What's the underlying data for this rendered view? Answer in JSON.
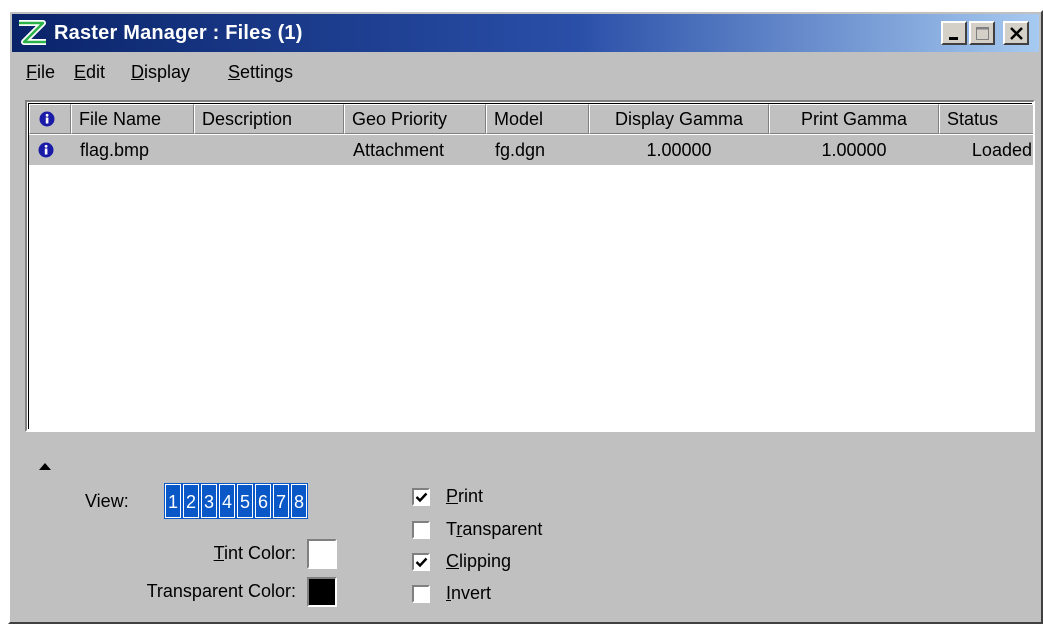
{
  "window": {
    "title": "Raster Manager : Files (1)"
  },
  "menu": [
    "File",
    "Edit",
    "Display",
    "Settings"
  ],
  "columns": [
    "File Name",
    "Description",
    "Geo Priority",
    "Model",
    "Display Gamma",
    "Print Gamma",
    "Status"
  ],
  "rows": [
    {
      "file_name": "flag.bmp",
      "description": "",
      "geo_priority": "Attachment",
      "model": "fg.dgn",
      "display_gamma": "1.00000",
      "print_gamma": "1.00000",
      "status": "Loaded"
    }
  ],
  "bottom": {
    "view_label": "View:",
    "views": [
      "1",
      "2",
      "3",
      "4",
      "5",
      "6",
      "7",
      "8"
    ],
    "tint_color_label": {
      "pre": "",
      "key": "T",
      "post": "int Color:"
    },
    "tint_color": "#ffffff",
    "transparent_color_label": "Transparent Color:",
    "transparent_color": "#000000",
    "options": [
      {
        "pre": "",
        "key": "P",
        "post": "rint",
        "checked": true
      },
      {
        "pre": "T",
        "key": "r",
        "post": "ansparent",
        "checked": false
      },
      {
        "pre": "",
        "key": "C",
        "post": "lipping",
        "checked": true
      },
      {
        "pre": "",
        "key": "I",
        "post": "nvert",
        "checked": false
      }
    ]
  },
  "colors": {
    "title_start": "#0a246a",
    "title_end": "#a6caf0",
    "face": "#c0c0c0",
    "view_button": "#0a58c8"
  }
}
